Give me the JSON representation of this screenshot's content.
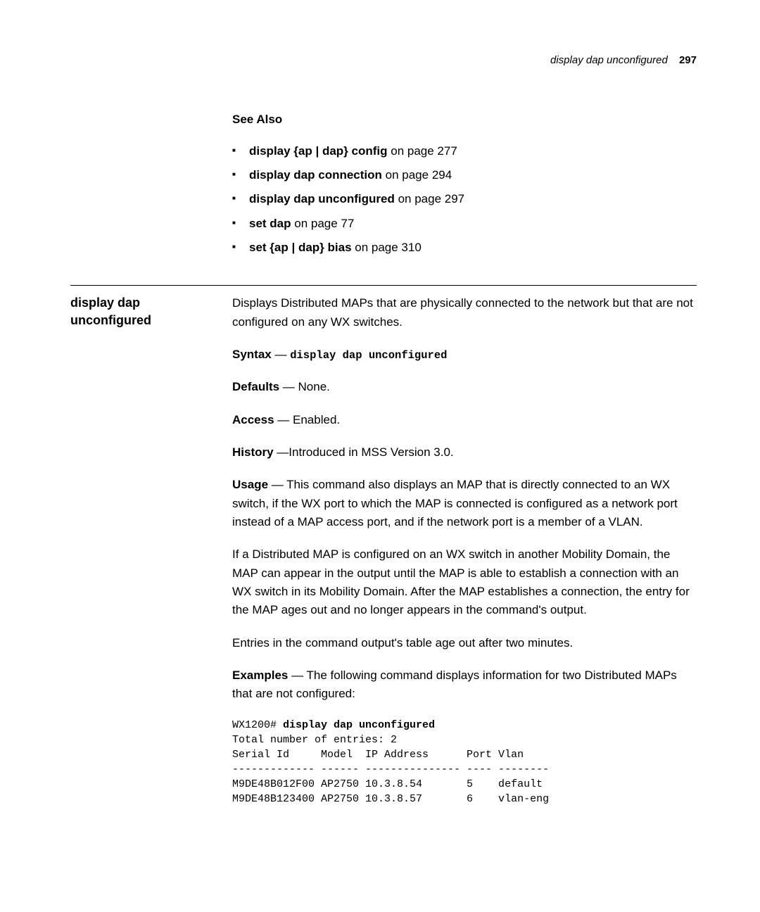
{
  "header": {
    "title": "display dap unconfigured",
    "page": "297"
  },
  "see_also": {
    "heading": "See Also",
    "items": [
      {
        "cmd": "display {ap | dap} config",
        "rest": " on page 277"
      },
      {
        "cmd": "display dap connection",
        "rest": " on page 294"
      },
      {
        "cmd": "display dap unconfigured",
        "rest": " on page 297"
      },
      {
        "cmd": "set dap",
        "rest": " on page 77"
      },
      {
        "cmd": "set {ap | dap} bias",
        "rest": " on page 310"
      }
    ]
  },
  "section": {
    "label_line1": "display dap",
    "label_line2": "unconfigured",
    "intro": "Displays Distributed MAPs that are physically connected to the network but that are not configured on any WX switches.",
    "syntax_label": "Syntax",
    "syntax_dash": " — ",
    "syntax_cmd": "display dap unconfigured",
    "defaults_label": "Defaults",
    "defaults_value": " — None.",
    "access_label": "Access",
    "access_value": " — Enabled.",
    "history_label": "History",
    "history_value": " —Introduced in MSS Version 3.0.",
    "usage_label": "Usage",
    "usage_value": " — This command also displays an MAP that is directly connected to an WX switch, if the WX port to which the MAP is connected is configured as a network port instead of a MAP access port, and if the network port is a member of a VLAN.",
    "usage_para2": "If a Distributed MAP is configured on an WX switch in another Mobility Domain, the MAP can appear in the output until the MAP is able to establish a connection with an WX switch in its Mobility Domain. After the MAP establishes a connection, the entry for the MAP ages out and no longer appears in the command's output.",
    "usage_para3": "Entries in the command output's table age out after two minutes.",
    "examples_label": "Examples",
    "examples_value": " — The following command displays information for two Distributed MAPs that are not configured:",
    "code": {
      "prompt": "WX1200# ",
      "cmd": "display dap unconfigured",
      "line2": "Total number of entries: 2",
      "line3": "Serial Id     Model  IP Address      Port Vlan",
      "line4": "------------- ------ --------------- ---- --------",
      "line5": "M9DE48B012F00 AP2750 10.3.8.54       5    default",
      "line6": "M9DE48B123400 AP2750 10.3.8.57       6    vlan-eng"
    }
  }
}
